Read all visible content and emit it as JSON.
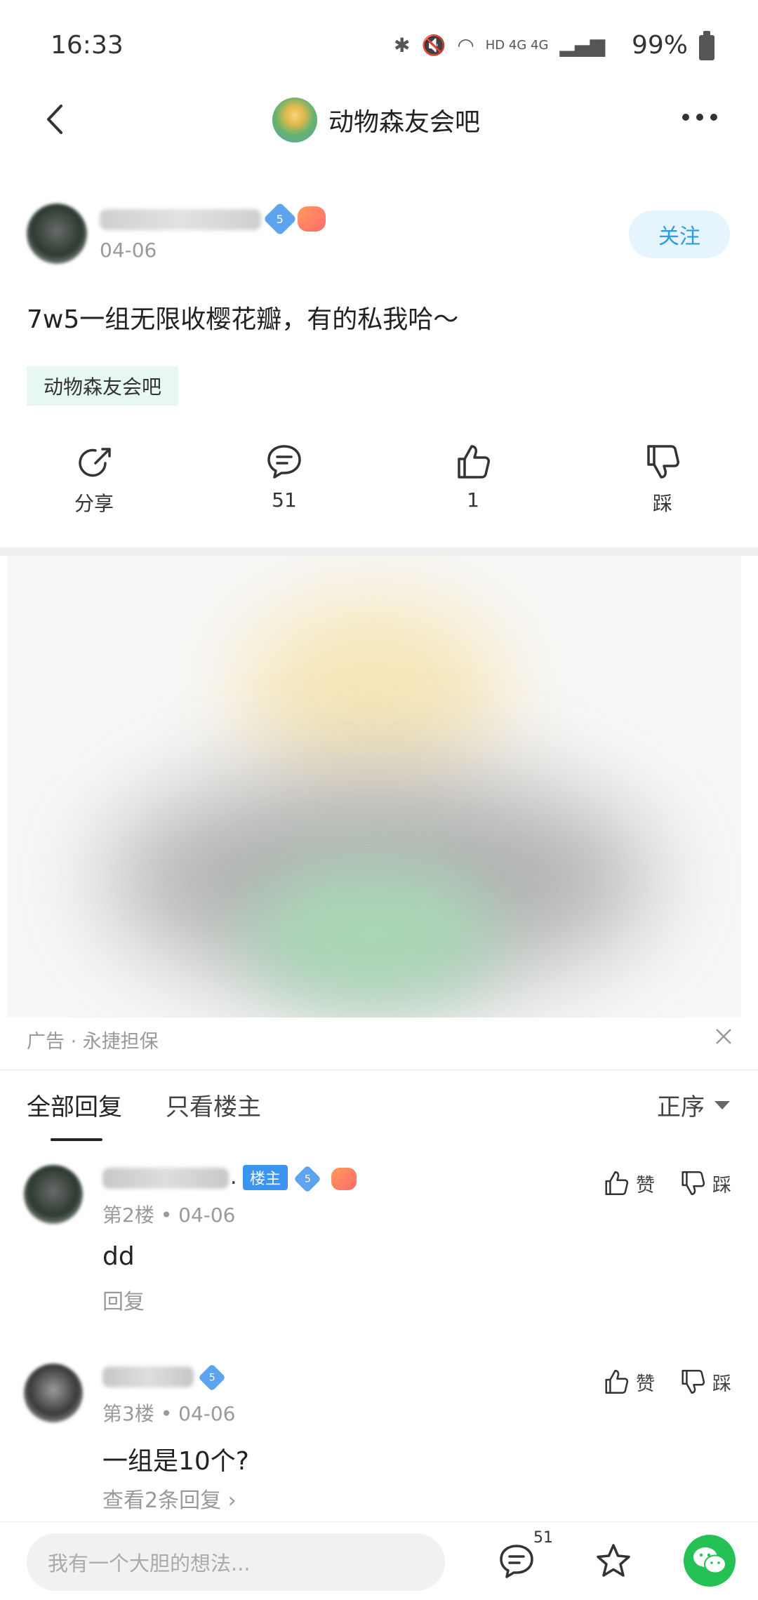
{
  "status_bar": {
    "time": "16:33",
    "network": "HD 4G 4G",
    "battery": "99%"
  },
  "nav": {
    "title": "动物森友会吧"
  },
  "post": {
    "date": "04-06",
    "level": "5",
    "follow_label": "关注",
    "text": "7w5一组无限收樱花瓣，有的私我哈～",
    "tag": "动物森友会吧",
    "actions": {
      "share": "分享",
      "comments": "51",
      "likes": "1",
      "dislike": "踩"
    }
  },
  "ad": {
    "label": "广告 · 永捷担保"
  },
  "replies": {
    "tab_all": "全部回复",
    "tab_op": "只看楼主",
    "sort": "正序"
  },
  "comments": [
    {
      "name_suffix": ".",
      "owner_badge": "楼主",
      "level": "5",
      "meta": "第2楼 • 04-06",
      "body": "dd",
      "sub": "回复",
      "like": "赞",
      "dislike": "踩"
    },
    {
      "level": "5",
      "meta": "第3楼 • 04-06",
      "body": "一组是10个?",
      "sub": "查看2条回复 ›",
      "like": "赞",
      "dislike": "踩"
    }
  ],
  "bottom": {
    "placeholder": "我有一个大胆的想法...",
    "comment_count": "51"
  },
  "colors": {
    "accent": "#2b9be8",
    "wechat": "#26c154",
    "tag_bg": "#e7f7f3"
  }
}
